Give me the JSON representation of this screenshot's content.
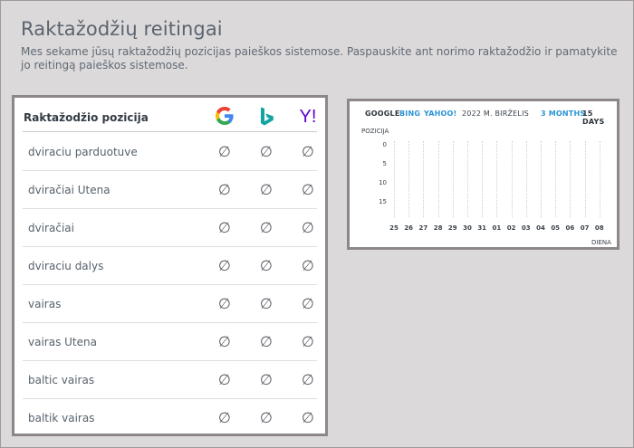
{
  "page": {
    "title": "Raktažodžių reitingai",
    "description": "Mes sekame jūsų raktažodžių pozicijas paieškos sistemose. Paspauskite ant norimo raktažodžio ir pamatykite jo reitingą paieškos sistemose."
  },
  "table": {
    "header_label": "Raktažodžio pozicija",
    "engines": [
      {
        "name": "google-icon",
        "glyph": "G"
      },
      {
        "name": "bing-icon",
        "glyph": "b"
      },
      {
        "name": "yahoo-icon",
        "glyph": "Y!"
      }
    ],
    "null_glyph": "∅",
    "rows": [
      {
        "keyword": "dviraciu parduotuve"
      },
      {
        "keyword": "dviračiai Utena"
      },
      {
        "keyword": "dviračiai"
      },
      {
        "keyword": "dviraciu dalys"
      },
      {
        "keyword": "vairas"
      },
      {
        "keyword": "vairas Utena"
      },
      {
        "keyword": "baltic vairas"
      },
      {
        "keyword": "baltik vairas"
      }
    ]
  },
  "chart": {
    "tabs": {
      "google": "GOOGLE",
      "bing": "BING",
      "yahoo": "YAHOO!",
      "month": "2022 M. BIRŽELIS",
      "three_months": "3 MONTHS",
      "fifteen_days": "15 DAYS"
    },
    "colors": {
      "active": "#2d333a",
      "link": "#2a93d5"
    }
  },
  "chart_data": {
    "type": "line",
    "ylabel": "POZICIJA",
    "xlabel": "DIENA",
    "yticks": [
      "0",
      "5",
      "10",
      "15"
    ],
    "ylim": [
      0,
      15
    ],
    "y_inverted": true,
    "categories": [
      "25",
      "26",
      "27",
      "28",
      "29",
      "30",
      "31",
      "01",
      "02",
      "03",
      "04",
      "05",
      "06",
      "07",
      "08"
    ],
    "series": []
  }
}
